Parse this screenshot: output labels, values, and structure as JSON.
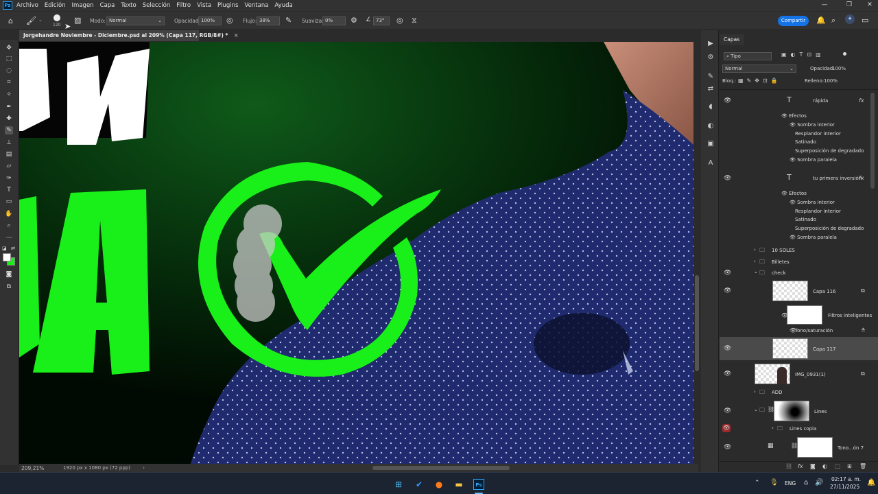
{
  "menu": [
    "Archivo",
    "Edición",
    "Imagen",
    "Capa",
    "Texto",
    "Selección",
    "Filtro",
    "Vista",
    "Plugins",
    "Ventana",
    "Ayuda"
  ],
  "app_badge": "Ps",
  "options": {
    "brush_size": "120",
    "mode_label": "Modo:",
    "mode_value": "Normal",
    "opacity_label": "Opacidad:",
    "opacity_value": "100%",
    "flow_label": "Flujo:",
    "flow_value": "38%",
    "smooth_label": "Suavizar:",
    "smooth_value": "0%",
    "angle_value": "73°",
    "share_label": "Compartir"
  },
  "doc_tab": {
    "title": "Jorgehandre Noviembre - Diciembre.psd al 209% (Capa 117, RGB/8#) *",
    "close": "×"
  },
  "status": {
    "zoom": "209,21%",
    "doc_size": "1920 px x 1080 px (72 ppp)"
  },
  "layers_panel": {
    "title": "Capas",
    "filter": "Tipo",
    "blend_mode": "Normal",
    "opacity_label": "Opacidad:",
    "opacity_value": "100%",
    "lock_label": "Bloq.:",
    "fill_label": "Relleno:",
    "fill_value": "100%",
    "text_layer_1": {
      "name": "rápida",
      "effects_label": "Efectos",
      "effects": [
        "Sombra interior",
        "Resplandor interior",
        "Satinado",
        "Superposición de degradado",
        "Sombra paralela"
      ]
    },
    "text_layer_2": {
      "name": "tu primera inversión",
      "effects_label": "Efectos",
      "effects": [
        "Sombra interior",
        "Resplandor interior",
        "Satinado",
        "Superposición de degradado",
        "Sombra paralela"
      ]
    },
    "group_10soles": "10 SOLES",
    "group_billetes": "Billetes",
    "group_check": "check",
    "capa116": "Capa 116",
    "smart_filters": "Filtros inteligentes",
    "hue_sat": "Tono/saturación",
    "capa117": "Capa 117",
    "img_layer": "IMG_0931(1)",
    "group_add": "ADD",
    "lines": "Lines",
    "lines_copy": "Lines copia",
    "tono7": "Tono...ón 7"
  },
  "canvas_text": {
    "top_letters": "ON",
    "bottom_letters": "DA"
  },
  "taskbar": {
    "lang": "ENG",
    "time": "02:17 a. m.",
    "date": "27/11/2025"
  },
  "colors": {
    "accent_green": "#19f019",
    "ps_blue": "#31a8ff",
    "share_blue": "#1473e6",
    "shirt_navy": "#1d2a6b"
  }
}
